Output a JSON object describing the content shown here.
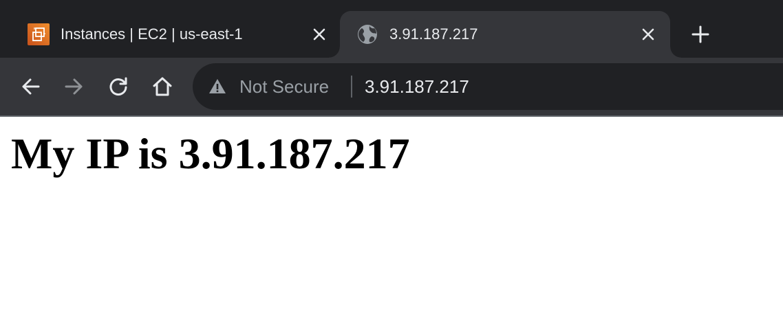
{
  "browser": {
    "tabs": [
      {
        "title": "Instances | EC2 | us-east-1",
        "favicon": "aws-ec2-icon",
        "active": false
      },
      {
        "title": "3.91.187.217",
        "favicon": "globe-icon",
        "active": true
      }
    ],
    "new_tab_icon": "plus-icon",
    "nav": {
      "back_icon": "back-arrow-icon",
      "forward_icon": "forward-arrow-icon",
      "reload_icon": "reload-icon",
      "home_icon": "home-icon"
    },
    "omnibox": {
      "security_icon": "warning-triangle-icon",
      "security_text": "Not Secure",
      "url": "3.91.187.217"
    },
    "colors": {
      "tabstrip_bg": "#202124",
      "active_tab_bg": "#35363a",
      "omnibox_bg": "#202124",
      "text_primary": "#e8eaed",
      "text_secondary": "#9aa0a6",
      "aws_orange": "#d0742a"
    }
  },
  "page": {
    "heading": "My IP is 3.91.187.217"
  }
}
